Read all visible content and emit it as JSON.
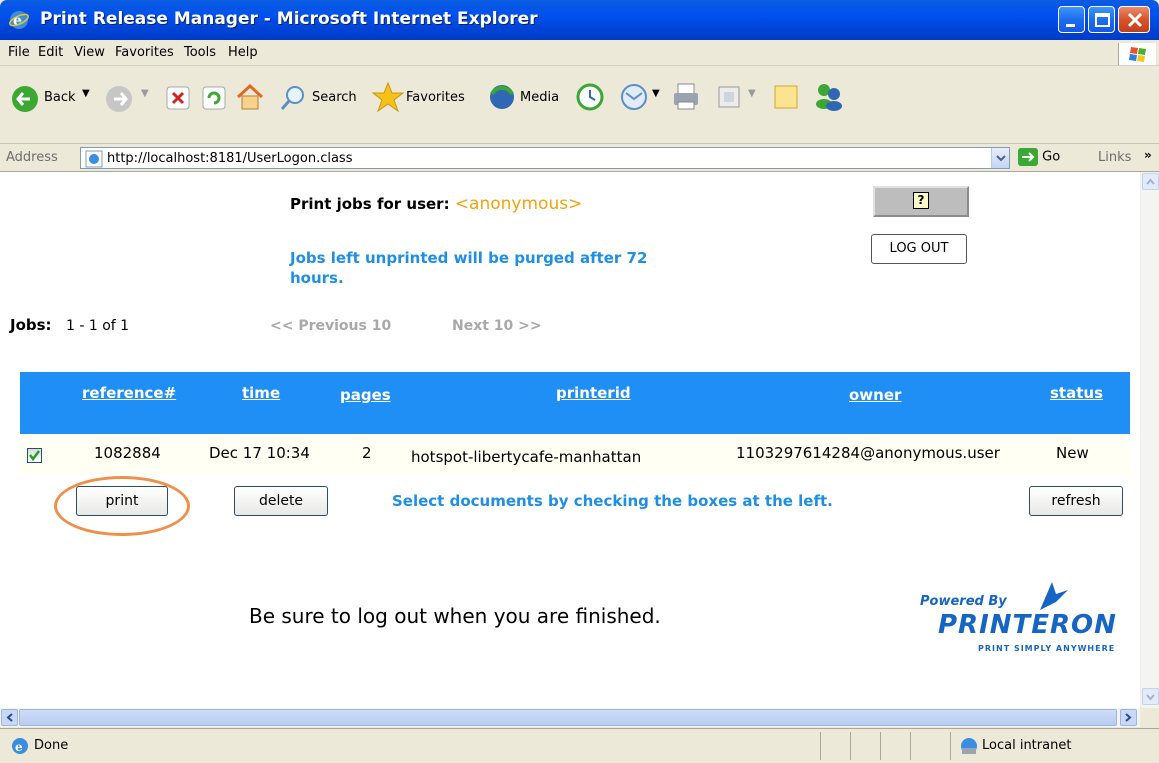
{
  "window": {
    "title": "Print Release Manager - Microsoft Internet Explorer"
  },
  "menu": [
    "File",
    "Edit",
    "View",
    "Favorites",
    "Tools",
    "Help"
  ],
  "toolbar": {
    "back": "Back",
    "search": "Search",
    "favorites": "Favorites",
    "media": "Media"
  },
  "address": {
    "label": "Address",
    "url": "http://localhost:8181/UserLogon.class",
    "go": "Go",
    "links": "Links"
  },
  "page": {
    "user_label": "Print jobs for user:",
    "user_name": "<anonymous>",
    "purge_notice": "Jobs left unprinted will be purged after 72 hours.",
    "help_label": "?",
    "logout_label": "LOG OUT",
    "jobs_label": "Jobs:",
    "jobs_range": "1 - 1 of 1",
    "prev_label": "<< Previous 10",
    "next_label": "Next 10 >>",
    "columns": [
      "reference#",
      "time",
      "pages",
      "printerid",
      "owner",
      "status"
    ],
    "rows": [
      {
        "checked": true,
        "reference": "1082884",
        "time": "Dec 17 10:34",
        "pages": "2",
        "printerid": "hotspot-libertycafe-manhattan",
        "owner": "1103297614284@anonymous.user",
        "status": "New"
      }
    ],
    "print_label": "print",
    "delete_label": "delete",
    "select_msg": "Select documents by checking the boxes at the left.",
    "refresh_label": "refresh",
    "logout_reminder": "Be sure to log out when you are finished.",
    "powered_by": "Powered By",
    "brand": "PRINTERON",
    "brand_tagline": "PRINT SIMPLY ANYWHERE"
  },
  "status": {
    "text": "Done",
    "zone": "Local intranet"
  },
  "colors": {
    "table_header": "#1f8ff5",
    "accent_blue": "#1e8fe3",
    "username": "#f4a20c",
    "annotation": "#f08e4a"
  }
}
